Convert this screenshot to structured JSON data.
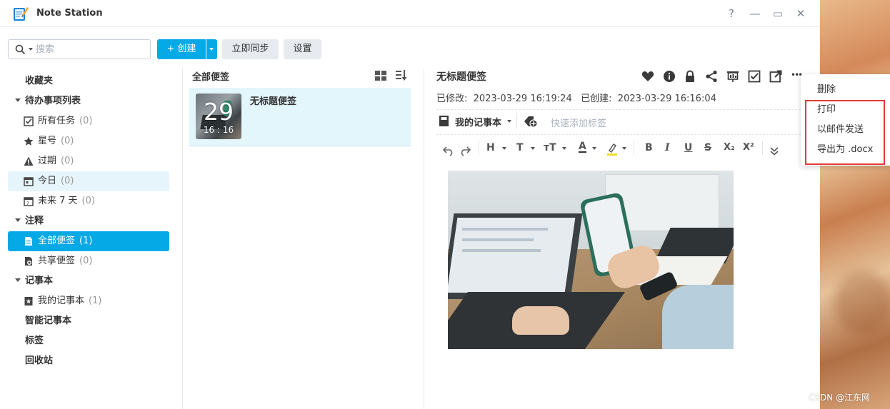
{
  "window": {
    "title": "Note Station",
    "help": "?",
    "minimize": "—",
    "maximize": "▭",
    "close": "✕"
  },
  "toolbar": {
    "search_placeholder": "搜索",
    "create_label": "+ 创建",
    "sync_label": "立即同步",
    "settings_label": "设置"
  },
  "sidebar": {
    "favorites": "收藏夹",
    "todo": {
      "header": "待办事项列表",
      "items": [
        {
          "label": "所有任务",
          "count": "(0)",
          "icon": "checkbox-icon"
        },
        {
          "label": "星号",
          "count": "(0)",
          "icon": "star-icon"
        },
        {
          "label": "过期",
          "count": "(0)",
          "icon": "warning-icon"
        },
        {
          "label": "今日",
          "count": "(0)",
          "icon": "calendar-icon"
        },
        {
          "label": "未来 7 天",
          "count": "(0)",
          "icon": "calendar-week-icon"
        }
      ]
    },
    "notes": {
      "header": "注释",
      "items": [
        {
          "label": "全部便签",
          "count": "(1)",
          "icon": "notes-icon"
        },
        {
          "label": "共享便签",
          "count": "(0)",
          "icon": "shared-notes-icon"
        }
      ]
    },
    "notebooks": {
      "header": "记事本",
      "items": [
        {
          "label": "我的记事本",
          "count": "(1)",
          "icon": "notebook-icon"
        }
      ]
    },
    "smart_notebook": "智能记事本",
    "tags": "标签",
    "recycle": "回收站"
  },
  "notelist": {
    "title": "全部便签",
    "notes": [
      {
        "title": "无标题便签",
        "day": "29",
        "time": "16 : 16"
      }
    ]
  },
  "editor": {
    "title": "无标题便签",
    "modified_label": "已修改:",
    "modified": "2023-03-29 16:19:24",
    "created_label": "已创建:",
    "created": "2023-03-29 16:16:04",
    "notebook": "我的记事本",
    "tag_placeholder": "快速添加标签",
    "format": {
      "heading": "H",
      "font": "T",
      "size": "тT",
      "color": "A",
      "bold": "B",
      "italic": "I",
      "underline": "U",
      "strike": "S",
      "subscript": "X₂",
      "superscript": "X²"
    },
    "more": "•••"
  },
  "menu": {
    "items": [
      "删除",
      "打印",
      "以邮件发送",
      "导出为 .docx"
    ]
  },
  "watermark": "CSDN @江东网",
  "colors": {
    "accent": "#05a9e6",
    "highlight": "#e53a3a"
  }
}
